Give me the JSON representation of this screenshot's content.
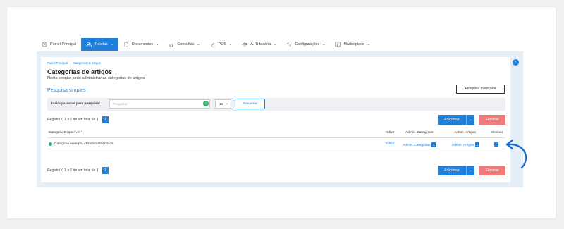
{
  "nav": {
    "items": [
      {
        "label": "Painel Principal",
        "icon": "clock-icon",
        "active": false,
        "has_menu": false
      },
      {
        "label": "Tabelas",
        "icon": "users-icon",
        "active": true,
        "has_menu": true
      },
      {
        "label": "Documentos",
        "icon": "document-icon",
        "active": false,
        "has_menu": true
      },
      {
        "label": "Consultas",
        "icon": "chart-icon",
        "active": false,
        "has_menu": true
      },
      {
        "label": "POS",
        "icon": "pos-icon",
        "active": false,
        "has_menu": true
      },
      {
        "label": "A. Tributária",
        "icon": "tax-icon",
        "active": false,
        "has_menu": true
      },
      {
        "label": "Configurações",
        "icon": "settings-icon",
        "active": false,
        "has_menu": true
      },
      {
        "label": "Marketplace",
        "icon": "marketplace-icon",
        "active": false,
        "has_menu": true
      }
    ],
    "chevron": "⌄"
  },
  "breadcrumb": {
    "home": "Painel Principal",
    "separator": "|",
    "current": "Categorias de artigos"
  },
  "page": {
    "title": "Categorias de artigos",
    "subtitle": "Nesta secção pode administrar as categorias de artigos"
  },
  "search": {
    "section_title": "Pesquisa simples",
    "advanced_label": "Pesquisa avançada",
    "label": "Insira palavras para pesquisar",
    "placeholder": "Pesquisar",
    "per_page": "10",
    "button_label": "Pesquisar"
  },
  "records": {
    "text": "Registo(s) 1 a 1 de um total de 1",
    "page": "1"
  },
  "actions": {
    "add_label": "Adicionar",
    "delete_label": "Eliminar"
  },
  "table": {
    "headers": {
      "name": "Categoria Disponível ^",
      "edit": "Editar",
      "admin_categories": "Admin. Categorias",
      "admin_articles": "Admin. Artigos",
      "delete": "Eliminar"
    },
    "rows": [
      {
        "name": "Categoria exemplo - Produtos/Serviços",
        "edit": "Editar",
        "admin_categories": "Admin. Categorias",
        "admin_categories_count": "1",
        "admin_articles": "Admin. Artigos",
        "admin_articles_count": "1",
        "checked": true
      }
    ]
  },
  "colors": {
    "accent": "#1f7fd9",
    "danger": "#f07a7a",
    "success": "#3cb371"
  }
}
